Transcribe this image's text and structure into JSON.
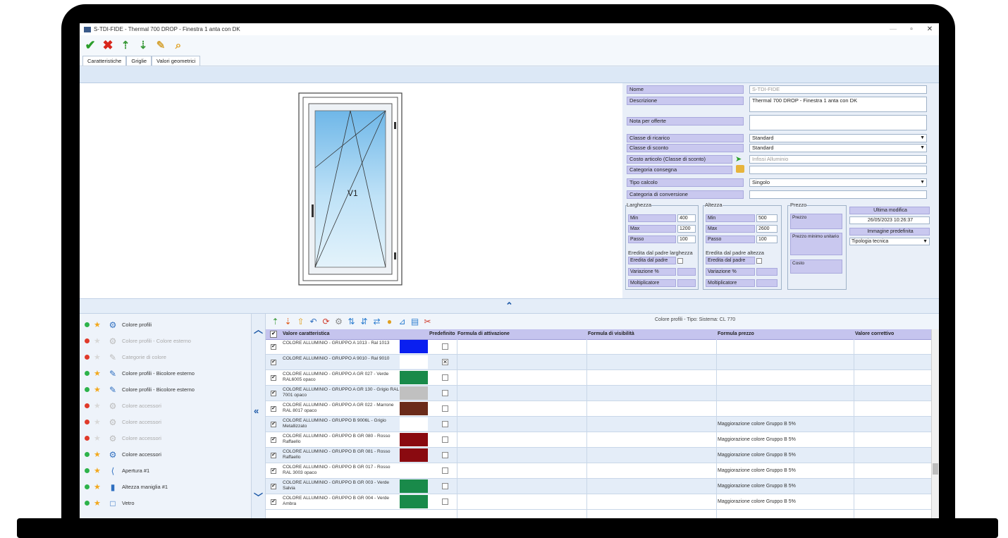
{
  "window": {
    "title": "S-TDI-FIDE - Thermal 700 DROP - Finestra 1 anta con DK",
    "close": "✕",
    "maximize": "▫",
    "minimize": "—"
  },
  "tabs": [
    "Caratteristiche",
    "Griglie",
    "Valori geometrici"
  ],
  "drawing": {
    "label": "V1"
  },
  "form": {
    "nome": {
      "label": "Nome",
      "value": "S-TDI-FIDE"
    },
    "descrizione": {
      "label": "Descrizione",
      "value": "Thermal 700 DROP - Finestra 1 anta con DK"
    },
    "nota": {
      "label": "Nota per offerte",
      "value": ""
    },
    "classe_ricarico": {
      "label": "Classe di ricarico",
      "value": "Standard"
    },
    "classe_sconto": {
      "label": "Classe di sconto",
      "value": "Standard"
    },
    "costo": {
      "label": "Costo articolo (Classe di sconto)",
      "value": "Infissi Alluminio"
    },
    "consegna": {
      "label": "Categoria consegna",
      "value": ""
    },
    "tipo_calcolo": {
      "label": "Tipo calcolo",
      "value": "Singolo"
    },
    "conversione": {
      "label": "Categoria di conversione",
      "value": ""
    },
    "larghezza": {
      "title": "Larghezza",
      "rows": [
        {
          "label": "Min",
          "value": "400"
        },
        {
          "label": "Max",
          "value": "1200"
        },
        {
          "label": "Passo",
          "value": "100"
        }
      ],
      "sub_title": "Eredita dal padre larghezza",
      "sub_rows": [
        {
          "label": "Eredita dal padre"
        },
        {
          "label": "Variazione %"
        },
        {
          "label": "Moltiplicatore"
        }
      ]
    },
    "altezza": {
      "title": "Altezza",
      "rows": [
        {
          "label": "Min",
          "value": "500"
        },
        {
          "label": "Max",
          "value": "2600"
        },
        {
          "label": "Passo",
          "value": "100"
        }
      ],
      "sub_title": "Eredita dal padre altezza",
      "sub_rows": [
        {
          "label": "Eredita dal padre"
        },
        {
          "label": "Variazione %"
        },
        {
          "label": "Moltiplicatore"
        }
      ]
    },
    "prezzo": {
      "title": "Prezzo",
      "rows": [
        "Prezzo",
        "Prezzo minimo unitario",
        "Costo"
      ]
    },
    "ultima_modifica": {
      "label": "Ultima modifica",
      "value": "26/05/2023 10:26:37"
    },
    "immagine": {
      "label": "Immagine predefinita",
      "value": "Tipologia tecnica"
    }
  },
  "left_items": [
    {
      "label": "Colore profili",
      "status": "#2db34a",
      "active": true,
      "icon": "gear-icon"
    },
    {
      "label": "Colore profili - Colore esterno",
      "status": "#e03a2a",
      "active": false,
      "icon": "gear-icon"
    },
    {
      "label": "Categorie di colore",
      "status": "#e03a2a",
      "active": false,
      "icon": "brush-icon"
    },
    {
      "label": "Colore profili - Bicolore esterno",
      "status": "#2db34a",
      "active": true,
      "icon": "brush-icon"
    },
    {
      "label": "Colore profili - Bicolore esterno",
      "status": "#2db34a",
      "active": true,
      "icon": "brush-icon"
    },
    {
      "label": "Colore accessori",
      "status": "#e03a2a",
      "active": false,
      "icon": "gear-icon"
    },
    {
      "label": "Colore accessori",
      "status": "#e03a2a",
      "active": false,
      "icon": "gear-icon"
    },
    {
      "label": "Colore accessori",
      "status": "#e03a2a",
      "active": false,
      "icon": "gear-icon"
    },
    {
      "label": "Colore accessori",
      "status": "#2db34a",
      "active": true,
      "icon": "gear-icon"
    },
    {
      "label": "Apertura #1",
      "status": "#2db34a",
      "active": true,
      "icon": "bracket-icon"
    },
    {
      "label": "Altezza maniglia #1",
      "status": "#2db34a",
      "active": true,
      "icon": "handle-icon"
    },
    {
      "label": "Vetro",
      "status": "#2db34a",
      "active": true,
      "icon": "square-icon"
    }
  ],
  "grid": {
    "caption": "Colore profili - Tipo: Sistema: CL 770",
    "headers": {
      "value": "Valore caratteristica",
      "predefinito": "Predefinito",
      "attivazione": "Formula di attivazione",
      "visibilita": "Formula di visibilità",
      "prezzo": "Formula prezzo",
      "correttivo": "Valore correttivo"
    },
    "rows": [
      {
        "desc": "COLORE ALLUMINIO - GRUPPO A 1013 - Ral 1013",
        "color": "#0a1ff0",
        "default": false,
        "prezzo": ""
      },
      {
        "desc": "COLORE ALLUMINIO - GRUPPO A 9010 - Ral 9010",
        "color": "#ffffff",
        "default": true,
        "prezzo": ""
      },
      {
        "desc": "COLORE ALLUMINIO - GRUPPO A GR 027 - Verde RAL6005 opaco",
        "color": "#198a4a",
        "default": false,
        "prezzo": ""
      },
      {
        "desc": "COLORE ALLUMINIO - GRUPPO A GR 130 - Grigio RAL 7001 opaco",
        "color": "#c0c0c0",
        "default": false,
        "prezzo": ""
      },
      {
        "desc": "COLORE ALLUMINIO - GRUPPO A GR 022 - Marrone RAL 8017 opaco",
        "color": "#6b2b1a",
        "default": false,
        "prezzo": ""
      },
      {
        "desc": "COLORE ALLUMINIO - GRUPPO B 9006L - Grigio Metallizzato",
        "color": "#ffffff",
        "default": false,
        "prezzo": "Maggiorazione colore Gruppo B 5%"
      },
      {
        "desc": "COLORE ALLUMINIO - GRUPPO B GR 080 - Rosso Raffaello",
        "color": "#8a0a10",
        "default": false,
        "prezzo": "Maggiorazione colore Gruppo B 5%"
      },
      {
        "desc": "COLORE ALLUMINIO - GRUPPO B GR 081 - Rosso Raffaello",
        "color": "#8a0a10",
        "default": false,
        "prezzo": "Maggiorazione colore Gruppo B 5%"
      },
      {
        "desc": "COLORE ALLUMINIO - GRUPPO B GR 017 - Rosso RAL 3003 opaco",
        "color": "#ffffff",
        "default": false,
        "prezzo": "Maggiorazione colore Gruppo B 5%"
      },
      {
        "desc": "COLORE ALLUMINIO - GRUPPO B GR 003 - Verde Salvia",
        "color": "#198a4a",
        "default": false,
        "prezzo": "Maggiorazione colore Gruppo B 5%"
      },
      {
        "desc": "COLORE ALLUMINIO - GRUPPO B GR 004 - Verde Ambra",
        "color": "#198a4a",
        "default": false,
        "prezzo": "Maggiorazione colore Gruppo B 5%"
      }
    ]
  }
}
